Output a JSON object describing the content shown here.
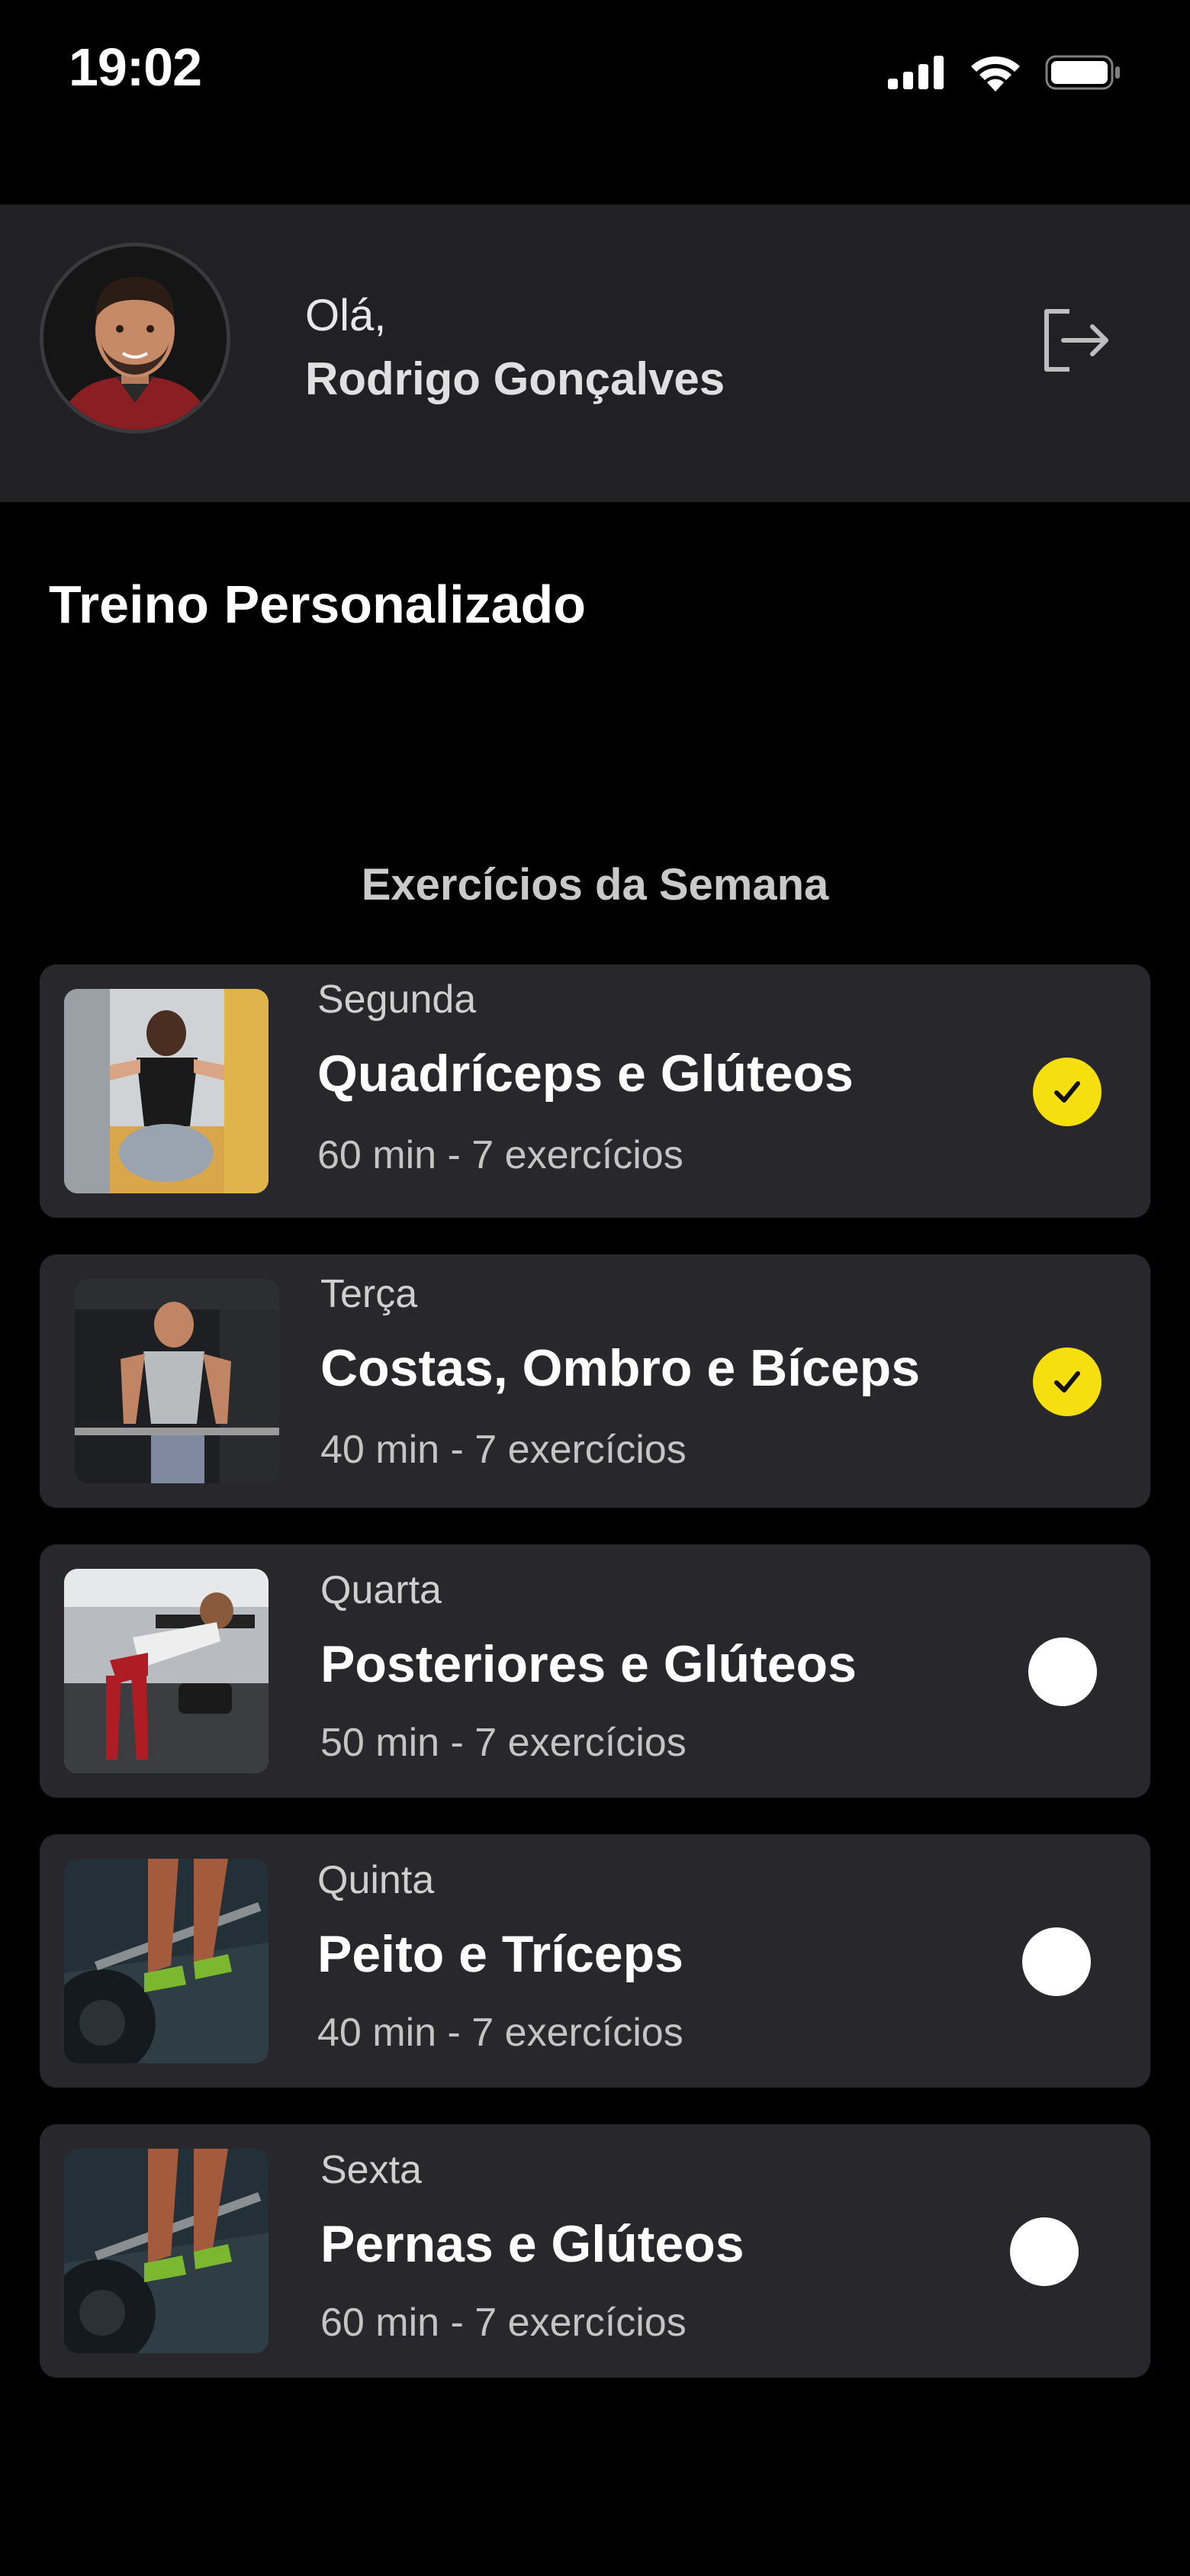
{
  "status_bar": {
    "time": "19:02"
  },
  "header": {
    "greeting": "Olá,",
    "user_name": "Rodrigo Gonçalves"
  },
  "page": {
    "title": "Treino Personalizado",
    "section_title": "Exercícios da Semana"
  },
  "colors": {
    "accent": "#f5df0e",
    "card_bg": "#28282c",
    "header_bg": "#212124"
  },
  "workouts": [
    {
      "day": "Segunda",
      "title": "Quadríceps e Glúteos",
      "meta": "60 min - 7 exercícios",
      "done": true
    },
    {
      "day": "Terça",
      "title": "Costas, Ombro e Bíceps",
      "meta": "40 min - 7 exercícios",
      "done": true
    },
    {
      "day": "Quarta",
      "title": "Posteriores e Glúteos",
      "meta": "50 min - 7 exercícios",
      "done": false
    },
    {
      "day": "Quinta",
      "title": "Peito e Tríceps",
      "meta": "40 min - 7 exercícios",
      "done": false
    },
    {
      "day": "Sexta",
      "title": "Pernas e Glúteos",
      "meta": "60 min - 7 exercícios",
      "done": false
    }
  ]
}
